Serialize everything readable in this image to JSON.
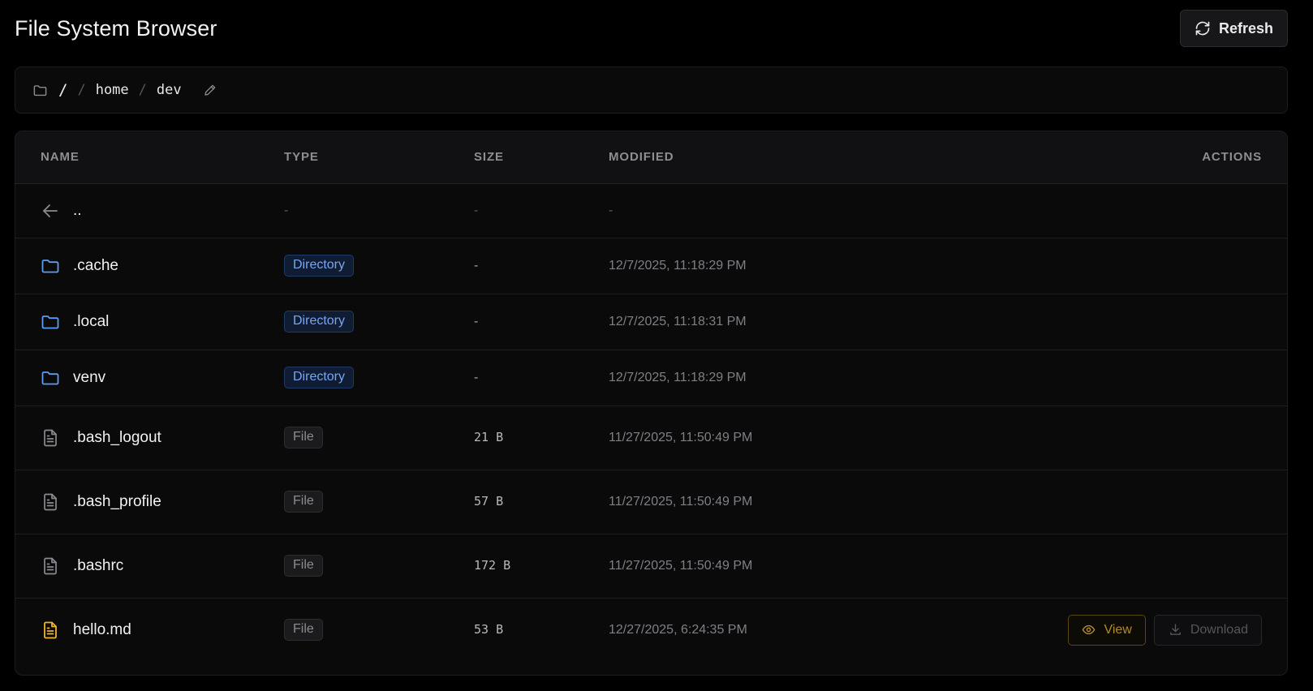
{
  "header": {
    "title": "File System Browser",
    "refresh_label": "Refresh"
  },
  "breadcrumb": {
    "root": "/",
    "separator": "/",
    "segments": [
      "home",
      "dev"
    ]
  },
  "table": {
    "columns": {
      "name": "NAME",
      "type": "TYPE",
      "size": "SIZE",
      "modified": "MODIFIED",
      "actions": "ACTIONS"
    },
    "parent": {
      "name": "..",
      "type": "-",
      "size": "-",
      "modified": "-"
    },
    "rows": [
      {
        "name": ".cache",
        "type": "Directory",
        "size": "-",
        "modified": "12/7/2025, 11:18:29 PM"
      },
      {
        "name": ".local",
        "type": "Directory",
        "size": "-",
        "modified": "12/7/2025, 11:18:31 PM"
      },
      {
        "name": "venv",
        "type": "Directory",
        "size": "-",
        "modified": "12/7/2025, 11:18:29 PM"
      },
      {
        "name": ".bash_logout",
        "type": "File",
        "size": "21 B",
        "modified": "11/27/2025, 11:50:49 PM"
      },
      {
        "name": ".bash_profile",
        "type": "File",
        "size": "57 B",
        "modified": "11/27/2025, 11:50:49 PM"
      },
      {
        "name": ".bashrc",
        "type": "File",
        "size": "172 B",
        "modified": "11/27/2025, 11:50:49 PM"
      },
      {
        "name": "hello.md",
        "type": "File",
        "size": "53 B",
        "modified": "12/27/2025, 6:24:35 PM"
      }
    ],
    "actions": {
      "view_label": "View",
      "download_label": "Download"
    }
  },
  "icons": {
    "refresh": "refresh-icon",
    "breadcrumb_folder": "folder-icon",
    "edit": "pencil-icon",
    "parent": "arrow-left-icon",
    "directory": "folder-icon",
    "file": "file-text-icon",
    "view": "eye-icon",
    "download": "download-icon"
  },
  "colors": {
    "background": "#000000",
    "surface": "#0a0a0b",
    "directory_accent": "#5b9cf5",
    "markdown_accent": "#f0b429",
    "view_accent": "#b38a2a",
    "muted_text": "#7f7f85"
  }
}
